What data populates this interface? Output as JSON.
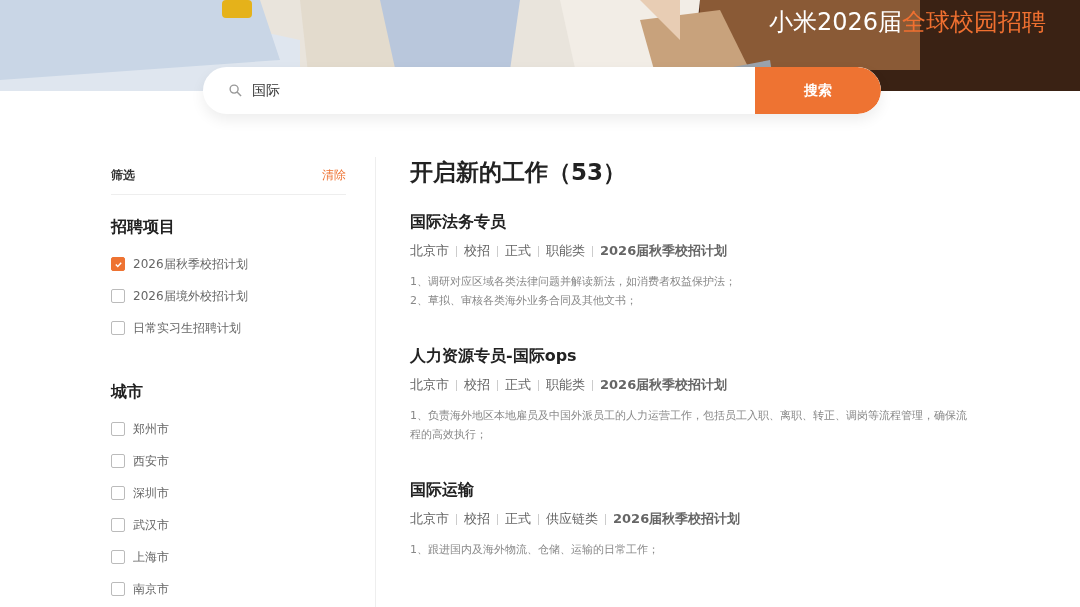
{
  "banner": {
    "title": [
      {
        "text": "小米2026届",
        "highlight": false
      },
      {
        "text": "全球校园招聘",
        "highlight": true
      }
    ]
  },
  "search": {
    "value": "国际",
    "button": "搜索"
  },
  "filters": {
    "title": "筛选",
    "clear": "清除",
    "groups": [
      {
        "title": "招聘项目",
        "options": [
          {
            "label": "2026届秋季校招计划",
            "checked": true
          },
          {
            "label": "2026届境外校招计划",
            "checked": false
          },
          {
            "label": "日常实习生招聘计划",
            "checked": false
          }
        ]
      },
      {
        "title": "城市",
        "options": [
          {
            "label": "郑州市",
            "checked": false
          },
          {
            "label": "西安市",
            "checked": false
          },
          {
            "label": "深圳市",
            "checked": false
          },
          {
            "label": "武汉市",
            "checked": false
          },
          {
            "label": "上海市",
            "checked": false
          },
          {
            "label": "南京市",
            "checked": false
          }
        ]
      }
    ]
  },
  "results": {
    "title": "开启新的工作（53）",
    "jobs": [
      {
        "title": "国际法务专员",
        "tags": [
          "北京市",
          "校招",
          "正式",
          "职能类",
          "2026届秋季校招计划"
        ],
        "description": [
          "1、调研对应区域各类法律问题并解读新法，如消费者权益保护法；",
          "2、草拟、审核各类海外业务合同及其他文书；"
        ]
      },
      {
        "title": "人力资源专员-国际ops",
        "tags": [
          "北京市",
          "校招",
          "正式",
          "职能类",
          "2026届秋季校招计划"
        ],
        "description": [
          "1、负责海外地区本地雇员及中国外派员工的人力运营工作，包括员工入职、离职、转正、调岗等流程管理，确保流程的高效执行；"
        ]
      },
      {
        "title": "国际运输",
        "tags": [
          "北京市",
          "校招",
          "正式",
          "供应链类",
          "2026届秋季校招计划"
        ],
        "description": [
          "1、跟进国内及海外物流、仓储、运输的日常工作；"
        ]
      }
    ]
  }
}
